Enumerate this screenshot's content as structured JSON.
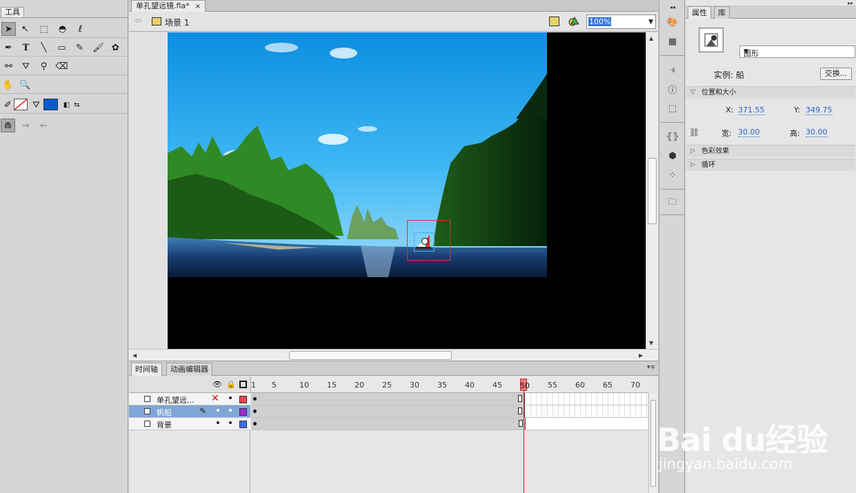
{
  "tools_panel": {
    "title": "工具"
  },
  "document": {
    "tab_title": "单孔望远镜.fla*",
    "close_glyph": "×"
  },
  "edit_bar": {
    "scene": "场景 1",
    "zoom": "100%"
  },
  "timeline": {
    "tabs": [
      "时间轴",
      "动画编辑器"
    ],
    "frame_numbers": [
      "1",
      "5",
      "10",
      "15",
      "20",
      "25",
      "30",
      "35",
      "40",
      "45",
      "50",
      "55",
      "60",
      "65",
      "70"
    ],
    "current_frame": "50",
    "layers": [
      {
        "name": "单孔望远...",
        "color": "#f04848"
      },
      {
        "name": "帆船",
        "color": "#9a2ad0"
      },
      {
        "name": "背景",
        "color": "#3f6ee8"
      }
    ]
  },
  "properties": {
    "tabs": [
      "属性",
      "库"
    ],
    "symbol_type": "图形",
    "instance_label": "实例: 船",
    "swap_button": "交换...",
    "section_position": "位置和大小",
    "x_label": "X:",
    "x_value": "371.55",
    "y_label": "Y:",
    "y_value": "349.75",
    "w_label": "宽:",
    "w_value": "30.00",
    "h_label": "高:",
    "h_value": "30.00",
    "section_color": "色彩效果",
    "section_loop": "循环"
  },
  "watermark": {
    "logo": "Bai du经验",
    "url": "jingyan.baidu.com"
  },
  "colors": {
    "stroke": "#ffffff",
    "fill": "#0a5cd0",
    "accent": "#3474d6",
    "playhead": "#d02020"
  }
}
